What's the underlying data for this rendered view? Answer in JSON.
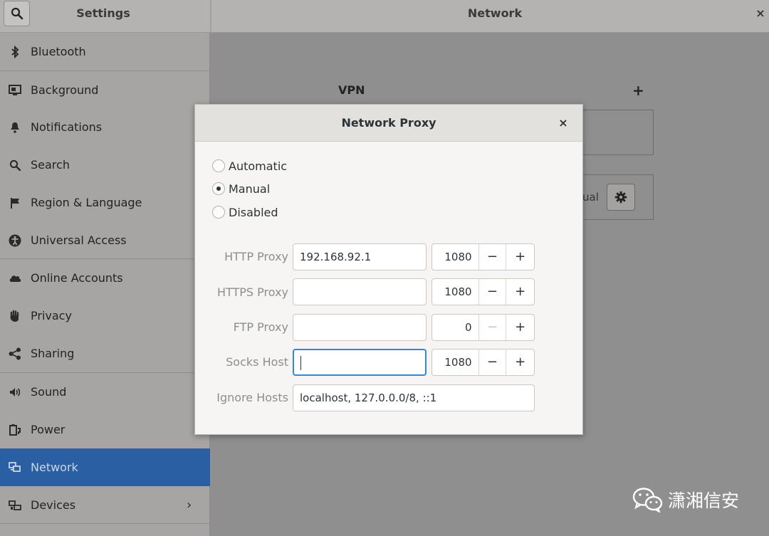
{
  "header": {
    "settings_title": "Settings",
    "panel_title": "Network",
    "close_glyph": "×",
    "search_icon": "search-icon"
  },
  "sidebar": {
    "items": [
      {
        "label": "Bluetooth",
        "icon": "bluetooth-icon"
      },
      {
        "label": "Background",
        "icon": "background-icon"
      },
      {
        "label": "Notifications",
        "icon": "bell-icon"
      },
      {
        "label": "Search",
        "icon": "search-icon"
      },
      {
        "label": "Region & Language",
        "icon": "flag-icon"
      },
      {
        "label": "Universal Access",
        "icon": "accessibility-icon"
      },
      {
        "label": "Online Accounts",
        "icon": "cloud-icon"
      },
      {
        "label": "Privacy",
        "icon": "hand-icon"
      },
      {
        "label": "Sharing",
        "icon": "share-icon"
      },
      {
        "label": "Sound",
        "icon": "speaker-icon"
      },
      {
        "label": "Power",
        "icon": "power-icon"
      },
      {
        "label": "Network",
        "icon": "network-icon",
        "active": true
      },
      {
        "label": "Devices",
        "icon": "devices-icon",
        "chevron": "›"
      }
    ]
  },
  "main": {
    "vpn_label": "VPN",
    "vpn_add": "+",
    "partial_text": "ual"
  },
  "dialog": {
    "title": "Network Proxy",
    "close_glyph": "×",
    "modes": [
      {
        "label": "Automatic",
        "checked": false
      },
      {
        "label": "Manual",
        "checked": true
      },
      {
        "label": "Disabled",
        "checked": false
      }
    ],
    "rows": [
      {
        "label": "HTTP Proxy",
        "host": "192.168.92.1",
        "port": "1080",
        "minus_disabled": false
      },
      {
        "label": "HTTPS Proxy",
        "host": "",
        "port": "1080",
        "minus_disabled": false
      },
      {
        "label": "FTP Proxy",
        "host": "",
        "port": "0",
        "minus_disabled": true
      },
      {
        "label": "Socks Host",
        "host": "",
        "port": "1080",
        "minus_disabled": false,
        "focused": true
      }
    ],
    "ignore": {
      "label": "Ignore Hosts",
      "value": "localhost, 127.0.0.0/8, ::1"
    },
    "minus_glyph": "−",
    "plus_glyph": "+"
  },
  "watermark": {
    "text": "潇湘信安",
    "icon": "wechat-icon"
  },
  "colors": {
    "accent": "#3584e4",
    "selected_row": "#2a5fa4"
  }
}
